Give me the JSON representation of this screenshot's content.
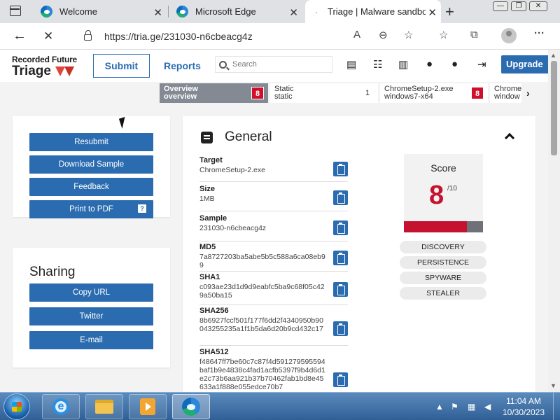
{
  "browser": {
    "tabs": [
      {
        "title": "Welcome"
      },
      {
        "title": "Microsoft Edge"
      },
      {
        "title": "Triage | Malware sandbo"
      }
    ],
    "url": "https://tria.ge/231030-n6cbeacg4z"
  },
  "site": {
    "brand_top": "Recorded Future",
    "brand_bottom": "Triage",
    "submit_label": "Submit",
    "reports_label": "Reports",
    "search_placeholder": "Search",
    "upgrade_label": "Upgrade"
  },
  "report_tabs": [
    {
      "line1": "Overview",
      "line2": "overview",
      "badge": "8"
    },
    {
      "line1": "Static",
      "line2": "static",
      "badge": "1"
    },
    {
      "line1": "ChromeSetup-2.exe",
      "line2": "windows7-x64",
      "badge": "8"
    },
    {
      "line1": "Chrome",
      "line2": "window"
    }
  ],
  "actions": {
    "resubmit": "Resubmit",
    "download": "Download Sample",
    "feedback": "Feedback",
    "print": "Print to PDF",
    "print_help": "?"
  },
  "sharing": {
    "title": "Sharing",
    "copy_url": "Copy URL",
    "twitter": "Twitter",
    "email": "E-mail"
  },
  "general": {
    "title": "General",
    "fields": [
      {
        "label": "Target",
        "value": "ChromeSetup-2.exe"
      },
      {
        "label": "Size",
        "value": "1MB"
      },
      {
        "label": "Sample",
        "value": "231030-n6cbeacg4z"
      },
      {
        "label": "MD5",
        "value": "7a8727203ba5abe5b5c588a6ca08eb99"
      },
      {
        "label": "SHA1",
        "value": "c093ae23d1d9d9eabfc5ba9c68f05c429a50ba15"
      },
      {
        "label": "SHA256",
        "value": "8b6927fccf501f177f6dd2f4340950b90043255235a1f1b5da6d20b9cd432c17"
      },
      {
        "label": "SHA512",
        "value": "f48647ff7be60c7c87f4d591279595594baf1b9e4838c4fad1acfb5397f9b4d6d1e2c73b6aa921b37b70462fab1bd8e45633a1f888e055edce70b7"
      }
    ],
    "score_label": "Score",
    "score_value": "8",
    "score_max": "/10",
    "score_fraction": 0.8,
    "tags": [
      "DISCOVERY",
      "PERSISTENCE",
      "SPYWARE",
      "STEALER"
    ]
  },
  "taskbar": {
    "time": "11:04 AM",
    "date": "10/30/2023"
  },
  "colors": {
    "accent": "#2b6cb0",
    "danger": "#c4122f"
  }
}
